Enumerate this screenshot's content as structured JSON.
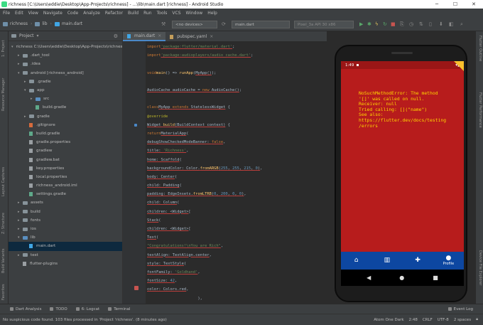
{
  "window": {
    "title": "richness [C:\\Users\\eddie\\Desktop\\App-Projects\\richness] - ...\\lib\\main.dart [richness] - Android Studio"
  },
  "menu": [
    "File",
    "Edit",
    "View",
    "Navigate",
    "Code",
    "Analyze",
    "Refactor",
    "Build",
    "Run",
    "Tools",
    "VCS",
    "Window",
    "Help"
  ],
  "breadcrumb": [
    "richness",
    "lib",
    "main.dart"
  ],
  "toolbar": {
    "device": "<no devices>",
    "config": "main.dart",
    "pixel": "Pixel_3a API 30 x86"
  },
  "left_strip": [
    "1: Project",
    "Resource Manager",
    "Layout Captures",
    "Z: Structure",
    "Build Variants",
    "Favorites"
  ],
  "right_strip": [
    "Flutter Outline",
    "Flutter Performance",
    "Device File Explorer",
    "Flutter Inspector"
  ],
  "project": {
    "header": "Project",
    "tree": [
      {
        "label": "richness  C:\\Users\\eddie\\Desktop\\App-Projects\\richness",
        "indent": 0,
        "arrow": "▾",
        "type": "fold"
      },
      {
        "label": ".dart_tool",
        "indent": 1,
        "arrow": "▸",
        "type": "fold"
      },
      {
        "label": ".idea",
        "indent": 1,
        "arrow": "▸",
        "type": "fold"
      },
      {
        "label": "android [richness_android]",
        "indent": 1,
        "arrow": "▾",
        "type": "fold"
      },
      {
        "label": ".gradle",
        "indent": 2,
        "arrow": "▸",
        "type": "fold"
      },
      {
        "label": "app",
        "indent": 2,
        "arrow": "▾",
        "type": "fold"
      },
      {
        "label": "src",
        "indent": 3,
        "arrow": "▸",
        "type": "src"
      },
      {
        "label": "build.gradle",
        "indent": 3,
        "arrow": "",
        "type": "grd"
      },
      {
        "label": "gradle",
        "indent": 2,
        "arrow": "▸",
        "type": "fold"
      },
      {
        "label": ".gitignore",
        "indent": 2,
        "arrow": "",
        "type": "git"
      },
      {
        "label": "build.gradle",
        "indent": 2,
        "arrow": "",
        "type": "grd"
      },
      {
        "label": "gradle.properties",
        "indent": 2,
        "arrow": "",
        "type": "file"
      },
      {
        "label": "gradlew",
        "indent": 2,
        "arrow": "",
        "type": "file"
      },
      {
        "label": "gradlew.bat",
        "indent": 2,
        "arrow": "",
        "type": "file"
      },
      {
        "label": "key.properties",
        "indent": 2,
        "arrow": "",
        "type": "file"
      },
      {
        "label": "local.properties",
        "indent": 2,
        "arrow": "",
        "type": "file"
      },
      {
        "label": "richness_android.iml",
        "indent": 2,
        "arrow": "",
        "type": "file"
      },
      {
        "label": "settings.gradle",
        "indent": 2,
        "arrow": "",
        "type": "grd"
      },
      {
        "label": "assets",
        "indent": 1,
        "arrow": "▸",
        "type": "fold"
      },
      {
        "label": "build",
        "indent": 1,
        "arrow": "▸",
        "type": "fold"
      },
      {
        "label": "fonts",
        "indent": 1,
        "arrow": "▸",
        "type": "fold"
      },
      {
        "label": "ios",
        "indent": 1,
        "arrow": "▸",
        "type": "fold"
      },
      {
        "label": "lib",
        "indent": 1,
        "arrow": "▾",
        "type": "src"
      },
      {
        "label": "main.dart",
        "indent": 2,
        "arrow": "",
        "type": "dart"
      },
      {
        "label": "test",
        "indent": 1,
        "arrow": "▸",
        "type": "fold"
      },
      {
        "label": "flutter-plugins",
        "indent": 1,
        "arrow": "",
        "type": "file"
      }
    ]
  },
  "tabs": [
    {
      "label": "main.dart",
      "active": true
    },
    {
      "label": "pubspec.yaml",
      "active": false
    }
  ],
  "emulator": {
    "time": "1:49",
    "error_text": "NoSuchMethodError: The method\n'[]' was called on null.\nReceiver: null\nTried calling: [](\"name\")\nSee also:\nhttps://flutter.dev/docs/testing\n/errors",
    "nav_items": [
      {
        "icon": "home-icon",
        "glyph": "⌂",
        "label": ""
      },
      {
        "icon": "chart-icon",
        "glyph": "▥",
        "label": ""
      },
      {
        "icon": "group-add-icon",
        "glyph": "✚",
        "label": ""
      },
      {
        "icon": "person-icon",
        "glyph": "●",
        "label": "Profile"
      }
    ]
  },
  "bottom_tools": [
    "Dart Analysis",
    "TODO",
    "6: Logcat",
    "Terminal"
  ],
  "right_tools": [
    "Event Log"
  ],
  "status": {
    "message": "No suspicious code found. 103 files processed in 'Project 'richness'. (8 minutes ago)",
    "theme": "Atom One Dark",
    "pos": "2:48",
    "crlf": "CRLF",
    "enc": "UTF-8",
    "indent": "2 spaces"
  }
}
